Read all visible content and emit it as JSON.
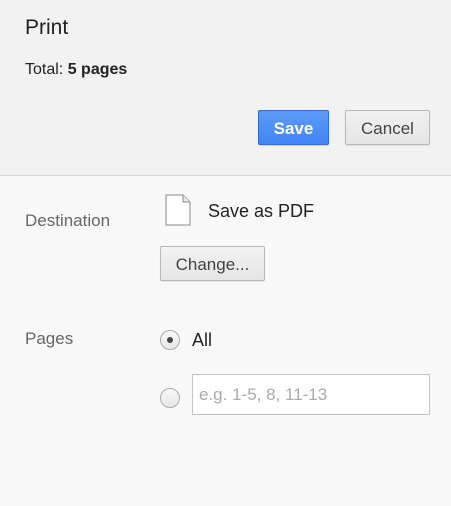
{
  "header": {
    "title": "Print",
    "total_label": "Total:",
    "total_value": "5 pages",
    "save_label": "Save",
    "cancel_label": "Cancel"
  },
  "destination": {
    "label": "Destination",
    "icon": "document-icon",
    "name": "Save as PDF",
    "change_label": "Change..."
  },
  "pages": {
    "label": "Pages",
    "options": [
      {
        "label": "All",
        "selected": true
      },
      {
        "label": "",
        "selected": false
      }
    ],
    "custom_input_value": "",
    "custom_input_placeholder": "e.g. 1-5, 8, 11-13"
  },
  "colors": {
    "accent": "#4285f4",
    "header_bg": "#f2f2f2",
    "body_bg": "#f9f9f9",
    "label_text": "#666666"
  }
}
